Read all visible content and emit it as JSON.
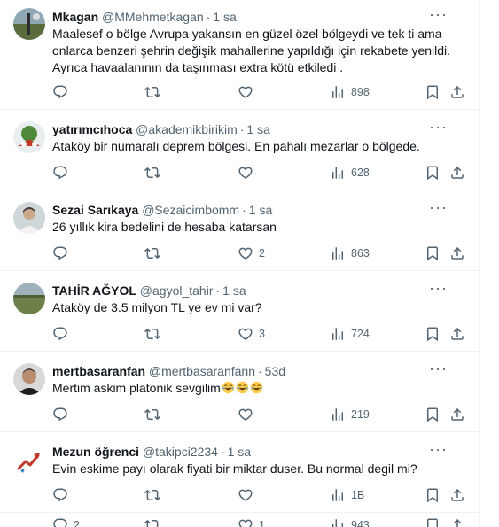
{
  "tweets": [
    {
      "name": "Mkagan",
      "handle": "@MMehmetkagan",
      "time": "1 sa",
      "text": "Maalesef o bölge Avrupa yakansın en güzel özel bölgeydi ve tek ti ama onlarca benzeri şehrin değişik mahallerine yapıldığı için rekabete yenildi. Ayrıca havaalanının da taşınması extra kötü etkiledi .",
      "replies": "",
      "retweets": "",
      "likes": "",
      "views": "898"
    },
    {
      "name": "yatırımcıhoca",
      "handle": "@akademikbirikim",
      "time": "1 sa",
      "text": "Ataköy bir numaralı deprem bölgesi. En pahalı mezarlar o bölgede.",
      "replies": "",
      "retweets": "",
      "likes": "",
      "views": "628"
    },
    {
      "name": "Sezai Sarıkaya",
      "handle": "@Sezaicimbomm",
      "time": "1 sa",
      "text": "26 yıllık kira bedelini de hesaba katarsan",
      "replies": "",
      "retweets": "",
      "likes": "2",
      "views": "863"
    },
    {
      "name": "TAHİR AĞYOL",
      "handle": "@agyol_tahir",
      "time": "1 sa",
      "text": "Ataköy de 3.5 milyon TL ye ev mi var?",
      "replies": "",
      "retweets": "",
      "likes": "3",
      "views": "724"
    },
    {
      "name": "mertbasaranfan",
      "handle": "@mertbasaranfann",
      "time": "53d",
      "text": "Mertim askim platonik sevgilim",
      "emoji_count": 3,
      "replies": "",
      "retweets": "",
      "likes": "",
      "views": "219"
    },
    {
      "name": "Mezun öğrenci",
      "handle": "@takipci2234",
      "time": "1 sa",
      "text": "Evin eskime payı olarak fiyati bir miktar duser. Bu normal degil mi?",
      "replies": "",
      "retweets": "",
      "likes": "",
      "views": "1B"
    }
  ],
  "bottom_bar": {
    "replies": "2",
    "retweets": "",
    "likes": "1",
    "views": "943"
  },
  "colors": {
    "text_primary": "#0f1419",
    "text_secondary": "#536471",
    "border": "#eff3f4"
  },
  "icons": [
    "reply-icon",
    "retweet-icon",
    "like-icon",
    "views-icon",
    "bookmark-icon",
    "share-icon",
    "more-icon"
  ]
}
